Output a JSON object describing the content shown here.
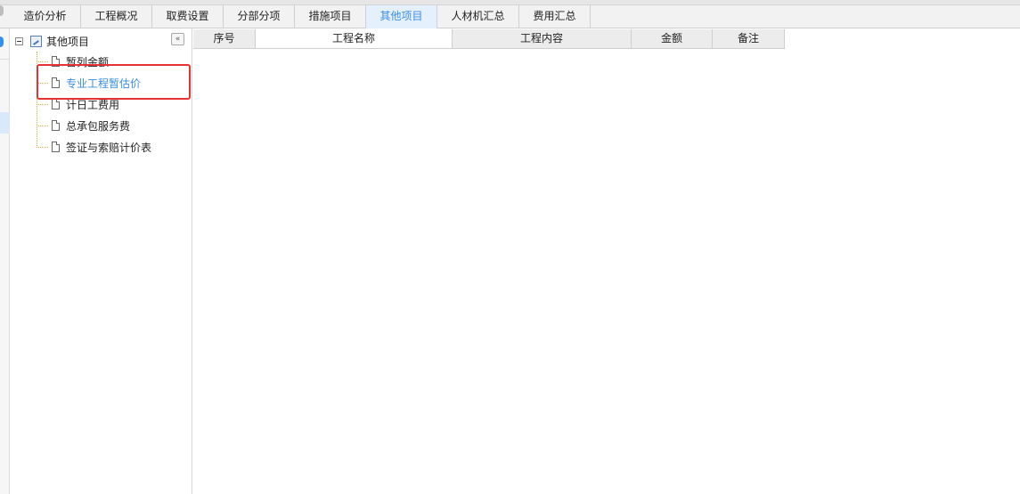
{
  "tabs": [
    {
      "label": "造价分析",
      "active": false
    },
    {
      "label": "工程概况",
      "active": false
    },
    {
      "label": "取费设置",
      "active": false
    },
    {
      "label": "分部分项",
      "active": false
    },
    {
      "label": "措施项目",
      "active": false
    },
    {
      "label": "其他项目",
      "active": true
    },
    {
      "label": "人材机汇总",
      "active": false
    },
    {
      "label": "费用汇总",
      "active": false
    }
  ],
  "tree": {
    "collapse_icon": "«",
    "root_label": "其他项目",
    "items": [
      {
        "label": "暂列金额",
        "selected": false
      },
      {
        "label": "专业工程暂估价",
        "selected": true
      },
      {
        "label": "计日工费用",
        "selected": false
      },
      {
        "label": "总承包服务费",
        "selected": false
      },
      {
        "label": "签证与索赔计价表",
        "selected": false
      }
    ]
  },
  "table": {
    "columns": [
      "序号",
      "工程名称",
      "工程内容",
      "金额",
      "备注"
    ]
  },
  "colors": {
    "accent": "#3a8ee6",
    "active_tab_bg": "#e4f0fb",
    "highlight_box": "#e83232"
  }
}
